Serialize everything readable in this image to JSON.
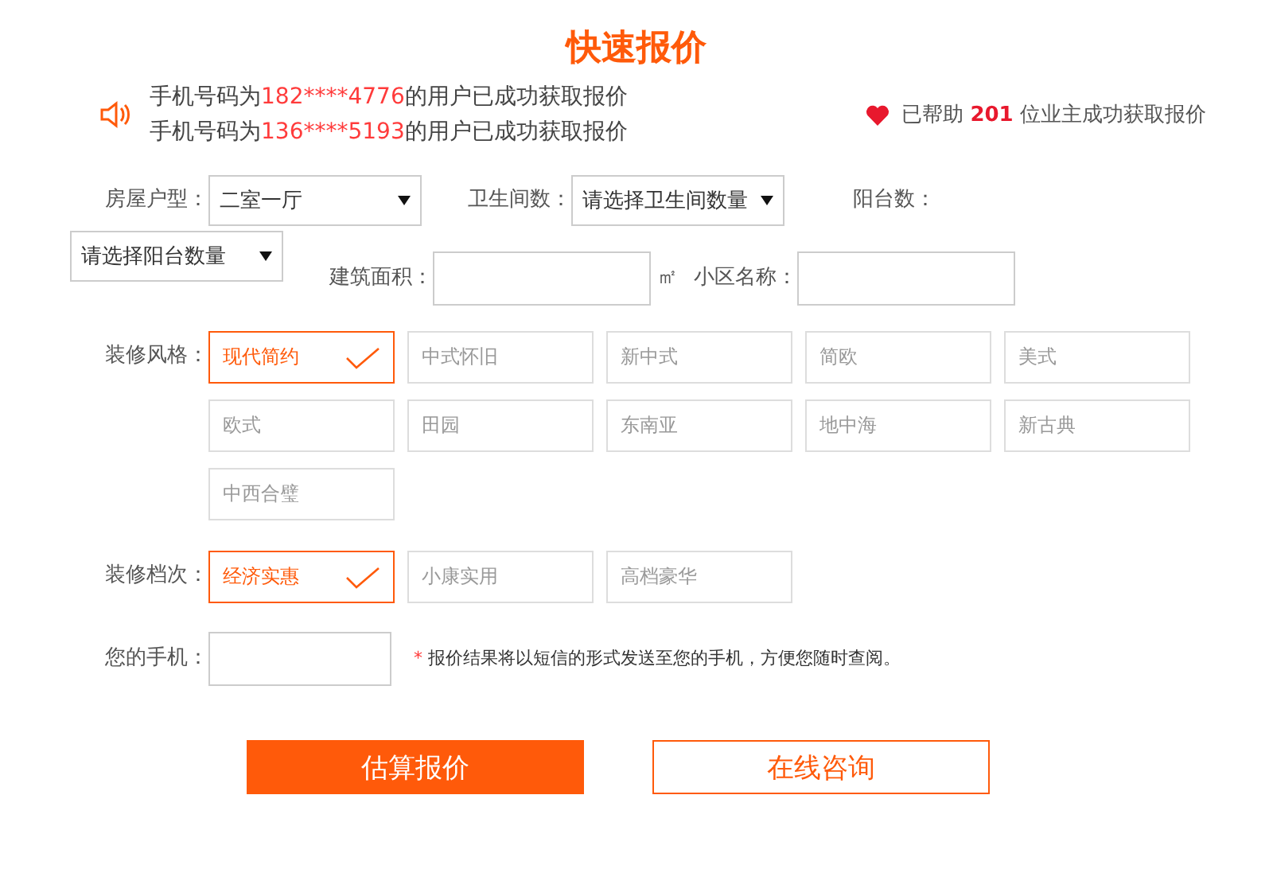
{
  "title": "快速报价",
  "ticker": [
    {
      "before": "手机号码为",
      "phone": "182****4776",
      "after": "的用户已成功获取报价"
    },
    {
      "before": "手机号码为",
      "phone": "136****5193",
      "after": "的用户已成功获取报价"
    }
  ],
  "helped": {
    "before": "已帮助",
    "count": "201",
    "after": "位业主成功获取报价"
  },
  "house_type": {
    "label": "房屋户型：",
    "value": "二室一厅"
  },
  "bathrooms": {
    "label": "卫生间数：",
    "placeholder": "请选择卫生间数量"
  },
  "balconies": {
    "label": "阳台数：",
    "placeholder": "请选择阳台数量"
  },
  "area": {
    "label": "建筑面积：",
    "unit": "㎡"
  },
  "community": {
    "label": "小区名称："
  },
  "style": {
    "label": "装修风格：",
    "options": [
      {
        "label": "现代简约",
        "selected": true
      },
      {
        "label": "中式怀旧",
        "selected": false
      },
      {
        "label": "新中式",
        "selected": false
      },
      {
        "label": "简欧",
        "selected": false
      },
      {
        "label": "美式",
        "selected": false
      },
      {
        "label": "欧式",
        "selected": false
      },
      {
        "label": "田园",
        "selected": false
      },
      {
        "label": "东南亚",
        "selected": false
      },
      {
        "label": "地中海",
        "selected": false
      },
      {
        "label": "新古典",
        "selected": false
      },
      {
        "label": "中西合璧",
        "selected": false
      }
    ]
  },
  "grade": {
    "label": "装修档次：",
    "options": [
      {
        "label": "经济实惠",
        "selected": true
      },
      {
        "label": "小康实用",
        "selected": false
      },
      {
        "label": "高档豪华",
        "selected": false
      }
    ]
  },
  "phone": {
    "label": "您的手机：",
    "note_mark": "*",
    "note": "报价结果将以短信的形式发送至您的手机，方便您随时查阅。"
  },
  "buttons": [
    {
      "label": "估算报价",
      "kind": "primary"
    },
    {
      "label": "在线咨询",
      "kind": "outline"
    }
  ]
}
